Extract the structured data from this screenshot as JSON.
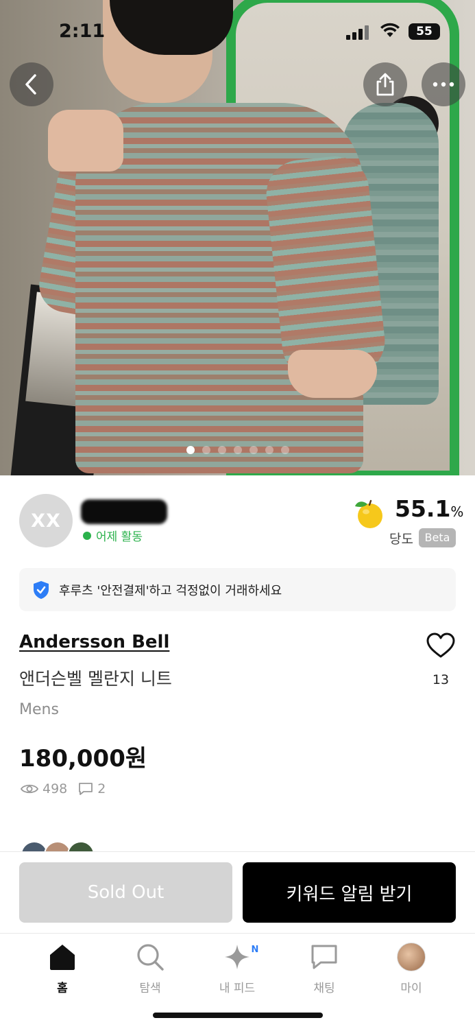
{
  "status_bar": {
    "time": "2:11",
    "battery": "55"
  },
  "photo": {
    "page_count": 7,
    "current_page": 1
  },
  "seller": {
    "avatar_initials": "XX",
    "activity": "어제 활동",
    "sweetness_value": "55.1",
    "sweetness_unit": "%",
    "sweetness_label": "당도",
    "beta_badge": "Beta"
  },
  "safe_payment": {
    "text": "후루츠 '안전결제'하고 걱정없이 거래하세요"
  },
  "product": {
    "brand": "Andersson Bell",
    "title": "앤더슨벨 멜란지 니트",
    "gender": "Mens",
    "price": "180,000원",
    "views": "498",
    "comments": "2",
    "likes": "13"
  },
  "actions": {
    "sold_out_label": "Sold Out",
    "keyword_alert_label": "키워드 알림 받기"
  },
  "tabbar": {
    "items": [
      {
        "label": "홈",
        "icon": "home-icon",
        "active": true
      },
      {
        "label": "탐색",
        "icon": "search-icon",
        "active": false
      },
      {
        "label": "내 피드",
        "icon": "sparkle-icon",
        "badge": "N",
        "active": false
      },
      {
        "label": "채팅",
        "icon": "chat-icon",
        "active": false
      },
      {
        "label": "마이",
        "icon": "profile-avatar",
        "active": false
      }
    ]
  },
  "colors": {
    "active_green": "#2bb24c",
    "primary_black": "#000000",
    "disabled_gray": "#d4d4d4"
  }
}
